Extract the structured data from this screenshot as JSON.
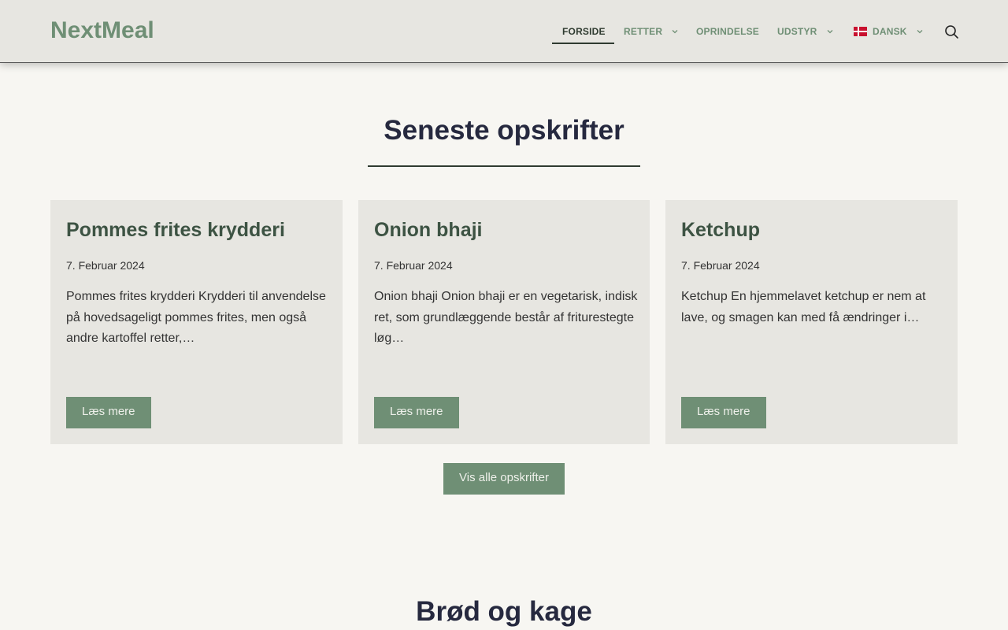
{
  "header": {
    "logo": "NextMeal",
    "nav": {
      "home": "FORSIDE",
      "dishes": "RETTER",
      "origin": "OPRINDELSE",
      "equipment": "UDSTYR",
      "language": "DANSK"
    },
    "icons": {
      "search": "search-icon",
      "chevron": "chevron-down-icon",
      "flag": "danish-flag-icon"
    }
  },
  "latest": {
    "title": "Seneste opskrifter",
    "cards": [
      {
        "title": "Pommes frites krydderi",
        "date": "7. Februar 2024",
        "excerpt": "Pommes frites krydderi Krydderi til anvendelse på hovedsageligt pommes frites, men også andre kartoffel retter,…",
        "button": "Læs mere"
      },
      {
        "title": "Onion bhaji",
        "date": "7. Februar 2024",
        "excerpt": "Onion bhaji Onion bhaji er en vegetarisk, indisk ret, som grundlæggende består af friturestegte løg…",
        "button": "Læs mere"
      },
      {
        "title": "Ketchup",
        "date": "7. Februar 2024",
        "excerpt": "Ketchup En hjemmelavet ketchup er nem at lave, og smagen kan med få ændringer i…",
        "button": "Læs mere"
      }
    ],
    "view_all": "Vis alle opskrifter"
  },
  "bread": {
    "title": "Brød og kage"
  },
  "colors": {
    "accent": "#6f8f75",
    "heading": "#26293f",
    "card_bg": "#e7e6e1",
    "page_bg": "#f7f6f2"
  }
}
